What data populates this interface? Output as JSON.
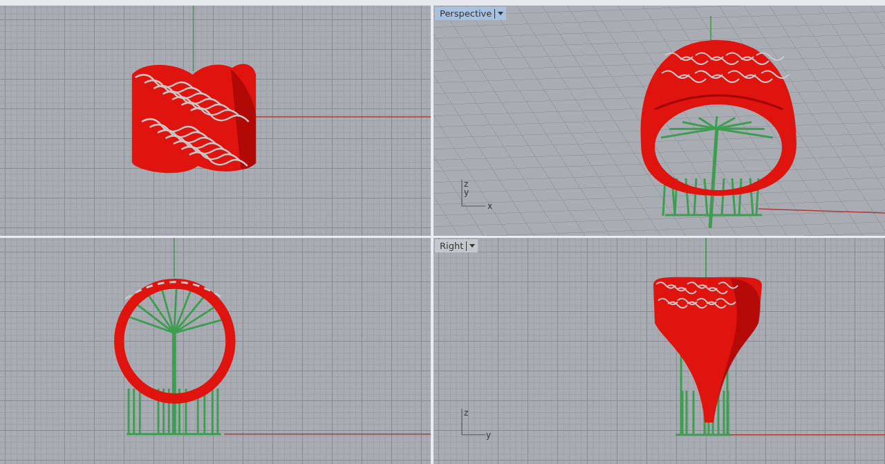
{
  "viewports": [
    {
      "kind": "band-front"
    },
    {
      "kind": "ring-perspective",
      "label": {
        "text": "Perspective",
        "selected": true
      },
      "axis_labels": [
        "z",
        "y",
        "x"
      ]
    },
    {
      "kind": "ring-front"
    },
    {
      "kind": "ring-right",
      "label": {
        "text": "Right",
        "selected": false
      },
      "axis_labels": [
        "z",
        "y"
      ]
    }
  ]
}
